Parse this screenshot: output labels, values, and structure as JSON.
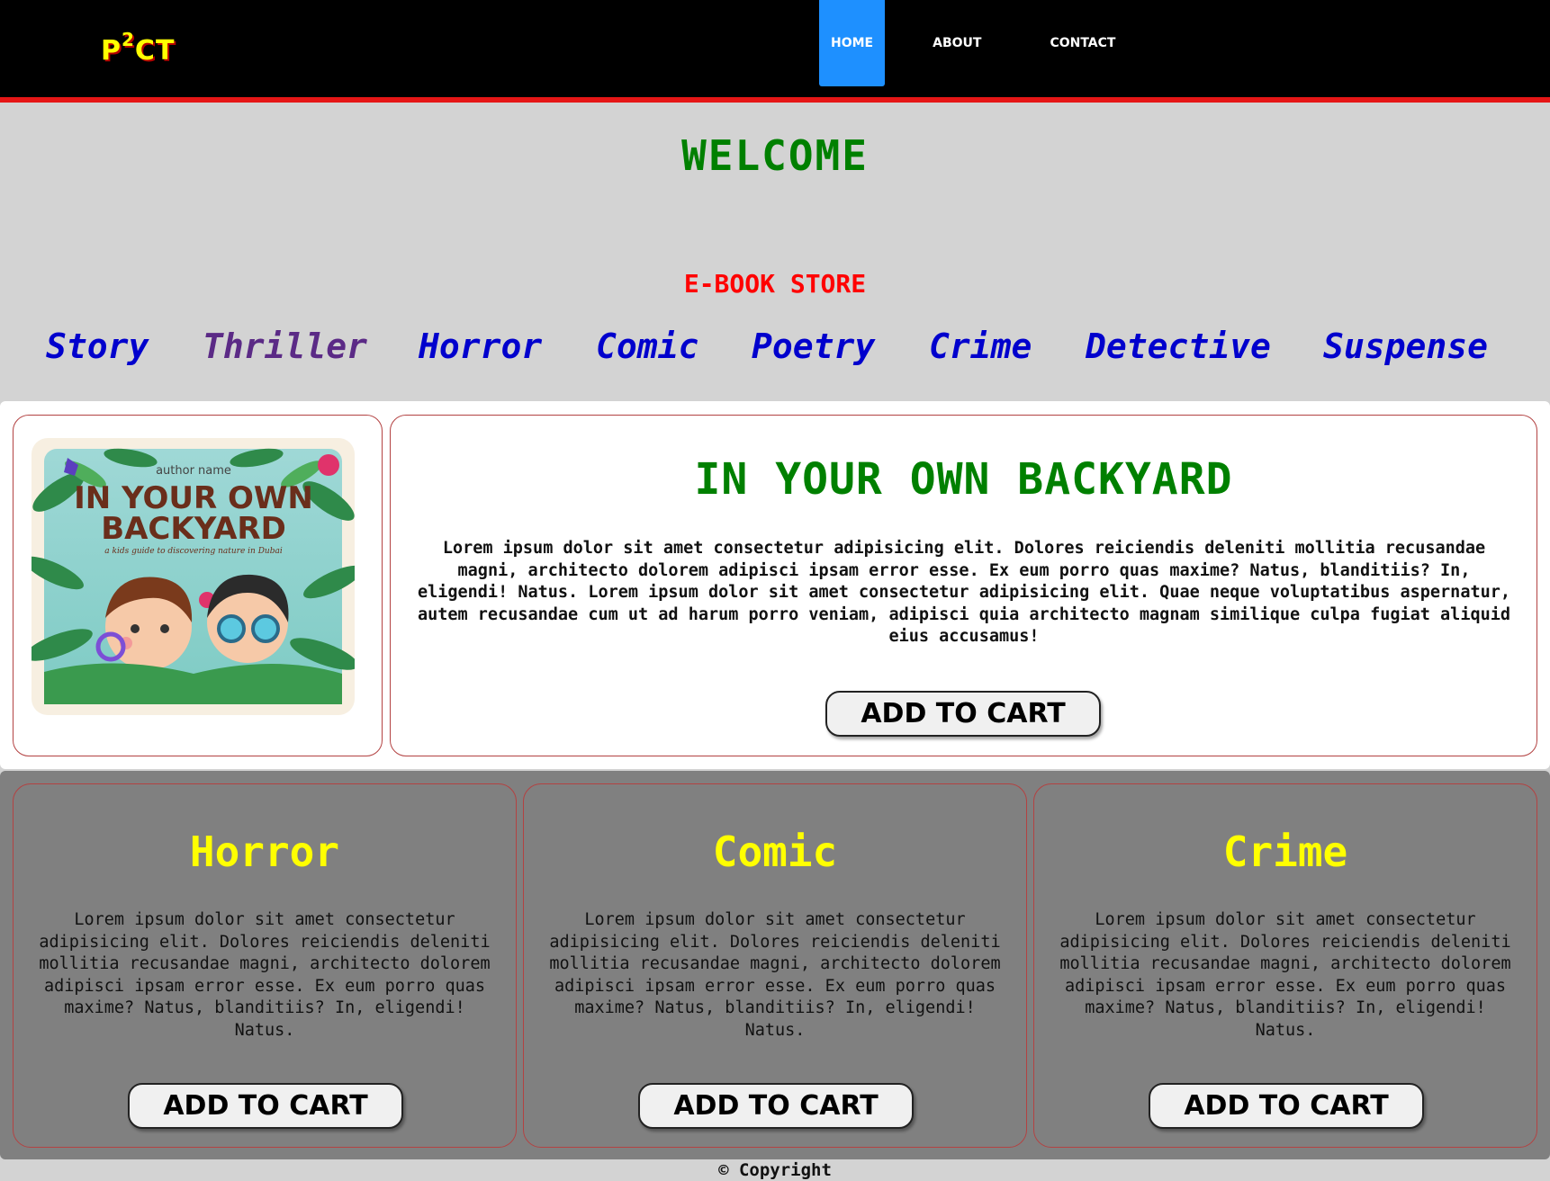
{
  "navbar": {
    "logo_prefix": "P",
    "logo_sup": "2",
    "logo_suffix": "CT",
    "items": [
      {
        "label": "HOME",
        "active": true
      },
      {
        "label": "ABOUT"
      },
      {
        "label": "CONTACT"
      }
    ]
  },
  "header": {
    "welcome": "WELCOME",
    "subtitle": "E-BOOK STORE"
  },
  "genres": [
    "Story",
    "Thriller",
    "Horror",
    "Comic",
    "Poetry",
    "Crime",
    "Detective",
    "Suspense"
  ],
  "feature": {
    "cover": {
      "author": "author name",
      "title_line1": "IN YOUR OWN",
      "title_line2": "BACKYARD",
      "tagline": "a kids guide to discovering nature in Dubai"
    },
    "title": "IN YOUR OWN BACKYARD",
    "description": "Lorem ipsum dolor sit amet consectetur adipisicing elit. Dolores reiciendis deleniti mollitia recusandae magni, architecto dolorem adipisci ipsam error esse. Ex eum porro quas maxime? Natus, blanditiis? In, eligendi! Natus. Lorem ipsum dolor sit amet consectetur adipisicing elit. Quae neque voluptatibus aspernatur, autem recusandae cum ut ad harum porro veniam, adipisci quia architecto magnam similique culpa fugiat aliquid eius accusamus!",
    "button": "ADD TO CART"
  },
  "cards": [
    {
      "title": "Horror",
      "description": "Lorem ipsum dolor sit amet consectetur adipisicing elit. Dolores reiciendis deleniti mollitia recusandae magni, architecto dolorem adipisci ipsam error esse. Ex eum porro quas maxime? Natus, blanditiis? In, eligendi! Natus.",
      "button": "ADD TO CART"
    },
    {
      "title": "Comic",
      "description": "Lorem ipsum dolor sit amet consectetur adipisicing elit. Dolores reiciendis deleniti mollitia recusandae magni, architecto dolorem adipisci ipsam error esse. Ex eum porro quas maxime? Natus, blanditiis? In, eligendi! Natus.",
      "button": "ADD TO CART"
    },
    {
      "title": "Crime",
      "description": "Lorem ipsum dolor sit amet consectetur adipisicing elit. Dolores reiciendis deleniti mollitia recusandae magni, architecto dolorem adipisci ipsam error esse. Ex eum porro quas maxime? Natus, blanditiis? In, eligendi! Natus.",
      "button": "ADD TO CART"
    }
  ],
  "footer": {
    "copyright": "© Copyright"
  },
  "colors": {
    "navbar_bg": "#000000",
    "navbar_border": "#e51616",
    "active_nav": "#1e90ff",
    "welcome": "#008000",
    "subtitle": "#ff0000",
    "genre_link": "#0000cd",
    "genre_visited": "#5b2a86",
    "card_title": "#ffff00",
    "cards_bg": "#808080",
    "page_bg": "#d3d3d3"
  }
}
